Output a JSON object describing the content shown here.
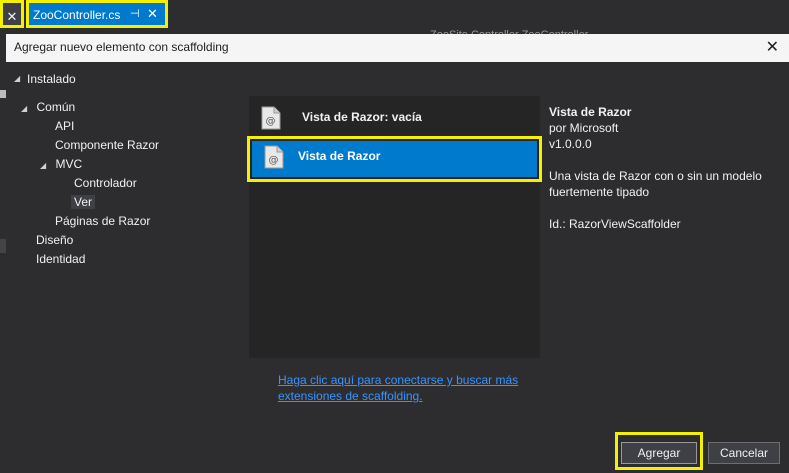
{
  "ide": {
    "left_close": "✕",
    "tab": {
      "name": "ZooController.cs",
      "pin": "⊣",
      "close": "✕"
    },
    "background_tabs": "ZooSite.Controller  ZooController"
  },
  "dialog": {
    "title": "Agregar nuevo elemento con scaffolding",
    "close": "✕",
    "installed": "Instalado",
    "tree": {
      "comun": "Común",
      "api": "API",
      "componente_razor": "Componente Razor",
      "mvc": "MVC",
      "controlador": "Controlador",
      "ver": "Ver",
      "paginas_razor": "Páginas de Razor",
      "diseno": "Diseño",
      "identidad": "Identidad"
    },
    "templates": [
      {
        "label": "Vista de Razor: vacía",
        "icon": "razor-file-icon"
      },
      {
        "label": "Vista de Razor",
        "icon": "razor-file-icon"
      }
    ],
    "details": {
      "title": "Vista de Razor",
      "author": "por Microsoft",
      "version": "v1.0.0.0",
      "description_line1": "Una vista de Razor con o sin un modelo",
      "description_line2": "fuertemente tipado",
      "id": "Id.: RazorViewScaffolder"
    },
    "online_link_line1": "Haga clic aquí para conectarse y buscar más",
    "online_link_line2": "extensiones de scaffolding.",
    "buttons": {
      "add": "Agregar",
      "cancel": "Cancelar"
    }
  },
  "colors": {
    "highlight": "#f5f000",
    "accent": "#007acc",
    "background": "#2d2d30",
    "panel": "#252526",
    "link": "#3794ff"
  }
}
